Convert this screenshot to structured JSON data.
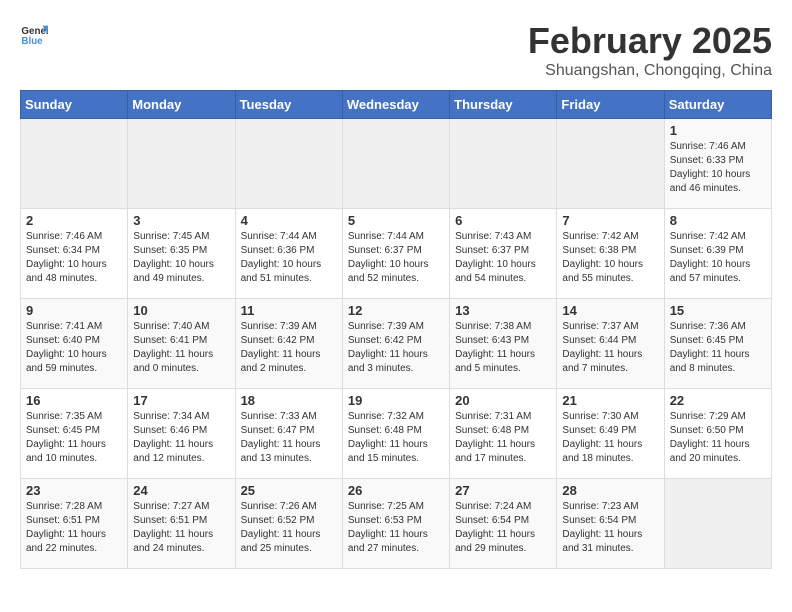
{
  "logo": {
    "general": "General",
    "blue": "Blue"
  },
  "title": "February 2025",
  "subtitle": "Shuangshan, Chongqing, China",
  "weekdays": [
    "Sunday",
    "Monday",
    "Tuesday",
    "Wednesday",
    "Thursday",
    "Friday",
    "Saturday"
  ],
  "weeks": [
    [
      {
        "day": "",
        "empty": true
      },
      {
        "day": "",
        "empty": true
      },
      {
        "day": "",
        "empty": true
      },
      {
        "day": "",
        "empty": true
      },
      {
        "day": "",
        "empty": true
      },
      {
        "day": "",
        "empty": true
      },
      {
        "day": "1",
        "sunrise": "7:46 AM",
        "sunset": "6:33 PM",
        "daylight": "10 hours and 46 minutes."
      }
    ],
    [
      {
        "day": "2",
        "sunrise": "7:46 AM",
        "sunset": "6:34 PM",
        "daylight": "10 hours and 48 minutes."
      },
      {
        "day": "3",
        "sunrise": "7:45 AM",
        "sunset": "6:35 PM",
        "daylight": "10 hours and 49 minutes."
      },
      {
        "day": "4",
        "sunrise": "7:44 AM",
        "sunset": "6:36 PM",
        "daylight": "10 hours and 51 minutes."
      },
      {
        "day": "5",
        "sunrise": "7:44 AM",
        "sunset": "6:37 PM",
        "daylight": "10 hours and 52 minutes."
      },
      {
        "day": "6",
        "sunrise": "7:43 AM",
        "sunset": "6:37 PM",
        "daylight": "10 hours and 54 minutes."
      },
      {
        "day": "7",
        "sunrise": "7:42 AM",
        "sunset": "6:38 PM",
        "daylight": "10 hours and 55 minutes."
      },
      {
        "day": "8",
        "sunrise": "7:42 AM",
        "sunset": "6:39 PM",
        "daylight": "10 hours and 57 minutes."
      }
    ],
    [
      {
        "day": "9",
        "sunrise": "7:41 AM",
        "sunset": "6:40 PM",
        "daylight": "10 hours and 59 minutes."
      },
      {
        "day": "10",
        "sunrise": "7:40 AM",
        "sunset": "6:41 PM",
        "daylight": "11 hours and 0 minutes."
      },
      {
        "day": "11",
        "sunrise": "7:39 AM",
        "sunset": "6:42 PM",
        "daylight": "11 hours and 2 minutes."
      },
      {
        "day": "12",
        "sunrise": "7:39 AM",
        "sunset": "6:42 PM",
        "daylight": "11 hours and 3 minutes."
      },
      {
        "day": "13",
        "sunrise": "7:38 AM",
        "sunset": "6:43 PM",
        "daylight": "11 hours and 5 minutes."
      },
      {
        "day": "14",
        "sunrise": "7:37 AM",
        "sunset": "6:44 PM",
        "daylight": "11 hours and 7 minutes."
      },
      {
        "day": "15",
        "sunrise": "7:36 AM",
        "sunset": "6:45 PM",
        "daylight": "11 hours and 8 minutes."
      }
    ],
    [
      {
        "day": "16",
        "sunrise": "7:35 AM",
        "sunset": "6:45 PM",
        "daylight": "11 hours and 10 minutes."
      },
      {
        "day": "17",
        "sunrise": "7:34 AM",
        "sunset": "6:46 PM",
        "daylight": "11 hours and 12 minutes."
      },
      {
        "day": "18",
        "sunrise": "7:33 AM",
        "sunset": "6:47 PM",
        "daylight": "11 hours and 13 minutes."
      },
      {
        "day": "19",
        "sunrise": "7:32 AM",
        "sunset": "6:48 PM",
        "daylight": "11 hours and 15 minutes."
      },
      {
        "day": "20",
        "sunrise": "7:31 AM",
        "sunset": "6:48 PM",
        "daylight": "11 hours and 17 minutes."
      },
      {
        "day": "21",
        "sunrise": "7:30 AM",
        "sunset": "6:49 PM",
        "daylight": "11 hours and 18 minutes."
      },
      {
        "day": "22",
        "sunrise": "7:29 AM",
        "sunset": "6:50 PM",
        "daylight": "11 hours and 20 minutes."
      }
    ],
    [
      {
        "day": "23",
        "sunrise": "7:28 AM",
        "sunset": "6:51 PM",
        "daylight": "11 hours and 22 minutes."
      },
      {
        "day": "24",
        "sunrise": "7:27 AM",
        "sunset": "6:51 PM",
        "daylight": "11 hours and 24 minutes."
      },
      {
        "day": "25",
        "sunrise": "7:26 AM",
        "sunset": "6:52 PM",
        "daylight": "11 hours and 25 minutes."
      },
      {
        "day": "26",
        "sunrise": "7:25 AM",
        "sunset": "6:53 PM",
        "daylight": "11 hours and 27 minutes."
      },
      {
        "day": "27",
        "sunrise": "7:24 AM",
        "sunset": "6:54 PM",
        "daylight": "11 hours and 29 minutes."
      },
      {
        "day": "28",
        "sunrise": "7:23 AM",
        "sunset": "6:54 PM",
        "daylight": "11 hours and 31 minutes."
      },
      {
        "day": "",
        "empty": true
      }
    ]
  ]
}
